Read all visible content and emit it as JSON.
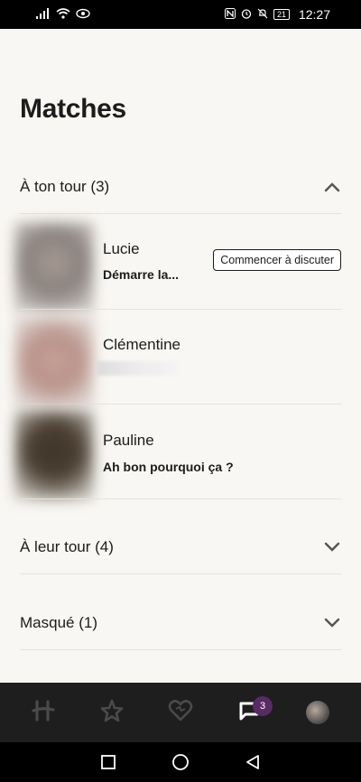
{
  "status_bar": {
    "signal_icon": "signal-icon",
    "wifi_icon": "wifi-icon",
    "battery_level": "21",
    "time": "12:27"
  },
  "page": {
    "title": "Matches"
  },
  "sections": [
    {
      "label": "À ton tour (3)",
      "expanded": true
    },
    {
      "label": "À leur tour (4)",
      "expanded": false
    },
    {
      "label": "Masqué (1)",
      "expanded": false
    }
  ],
  "matches": [
    {
      "name": "Lucie",
      "message": "Démarre la...",
      "action_label": "Commencer à discuter",
      "avatar_color": "#8a827e"
    },
    {
      "name": "Clémentine",
      "message": "",
      "avatar_color": "#b99289"
    },
    {
      "name": "Pauline",
      "message": "Ah bon pourquoi ça ?",
      "avatar_color": "#4c4033"
    }
  ],
  "tab_bar": {
    "tabs": [
      {
        "icon": "hinge-logo-icon"
      },
      {
        "icon": "star-icon"
      },
      {
        "icon": "heart-icon"
      },
      {
        "icon": "chat-icon",
        "badge": "3",
        "active": true
      },
      {
        "icon": "profile-avatar"
      }
    ]
  },
  "colors": {
    "background": "#f9f7f3",
    "badge": "#5a2a64",
    "tab_bar": "#1e1e1e"
  }
}
